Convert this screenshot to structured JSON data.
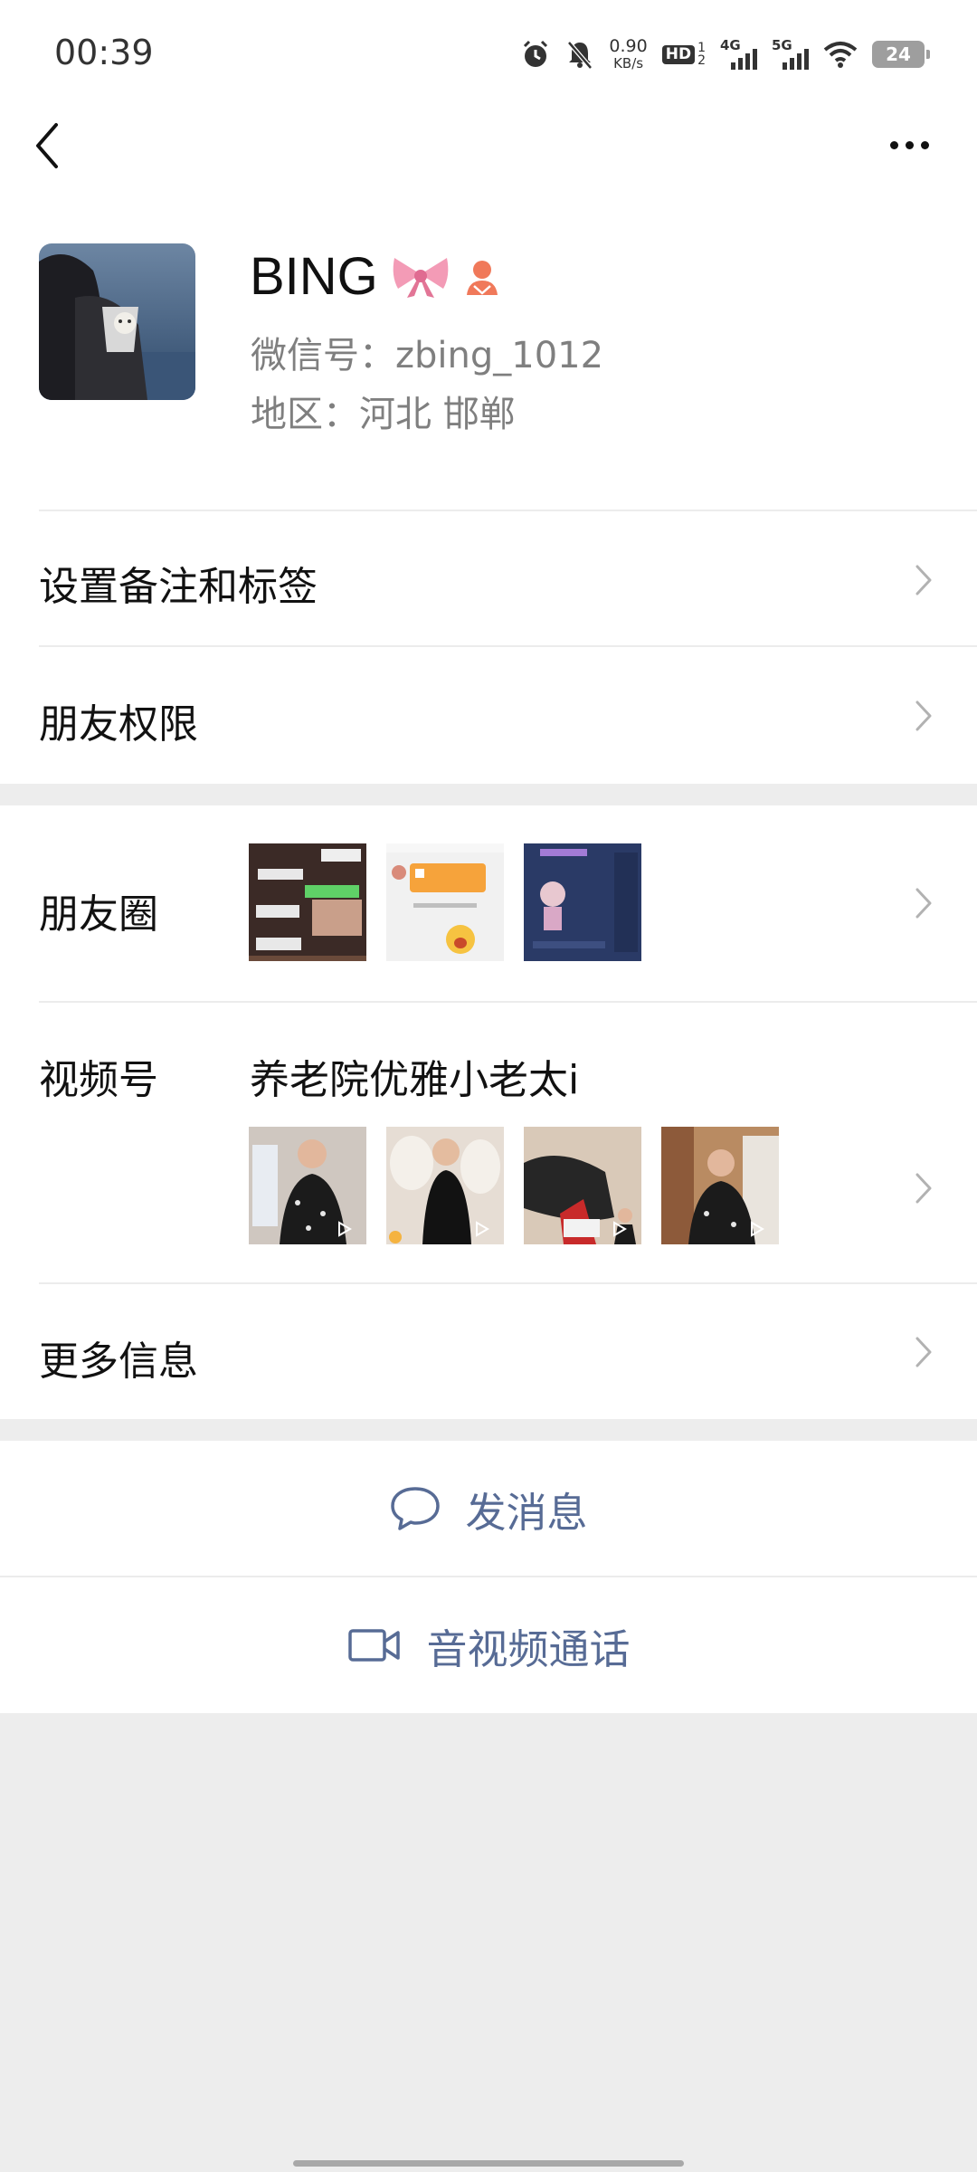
{
  "status_bar": {
    "time": "00:39",
    "net_speed_value": "0.90",
    "net_speed_unit": "KB/s",
    "hd_label": "HD",
    "hd_slot_1": "1",
    "hd_slot_2": "2",
    "net_1": "4G",
    "net_2": "5G",
    "battery": "24"
  },
  "nav": {
    "back_icon": "chevron-left-icon",
    "more_icon": "more-dots-icon"
  },
  "profile": {
    "name": "BING",
    "wechat_id": "微信号：zbing_1012",
    "region": "地区：河北  邯郸"
  },
  "rows": {
    "remark_tags": "设置备注和标签",
    "friend_permissions": "朋友权限",
    "moments": "朋友圈",
    "channels": "视频号",
    "channels_name": "养老院优雅小老太i",
    "more_info": "更多信息"
  },
  "actions": {
    "send_message": "发消息",
    "av_call": "音视频通话"
  },
  "colors": {
    "accent": "#576b95",
    "background": "#ededed"
  }
}
